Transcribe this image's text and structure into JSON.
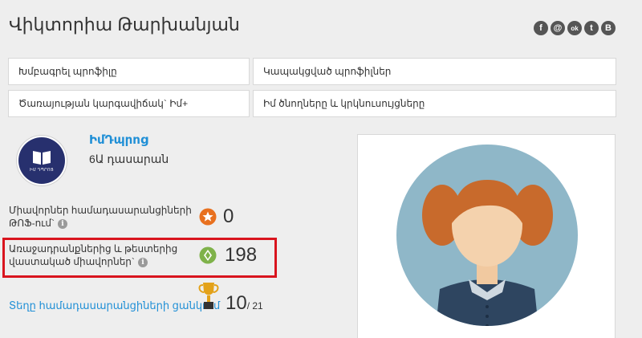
{
  "header": {
    "title": "Վիկտորիա Թարխանյան"
  },
  "socials": [
    {
      "glyph": "f"
    },
    {
      "glyph": "@"
    },
    {
      "glyph": "ok"
    },
    {
      "glyph": "t"
    },
    {
      "glyph": "B"
    }
  ],
  "menu": {
    "edit_profile": "Խմբագրել պրոֆիլը",
    "linked_profiles": "Կապակցված պրոֆիլներ",
    "service_status": "Ծառայության կարգավիճակ` Իմ+",
    "parents_teachers": "Իմ ծնողները և կրկնուսույցները"
  },
  "school": {
    "name": "ԻմԴպրոց",
    "grade": "6Ա դասարան",
    "badge_caption": "ԻՄ ԴՊՐՈՑ"
  },
  "stats": {
    "tof_label_line1": "Միավորներ համադասարանցիների",
    "tof_label_line2": "ԹՈՖ-ում`",
    "tof_value": "0",
    "tests_label_line1": "Առաջադրանքներից և թեստերից",
    "tests_label_line2": "վաստակած միավորներ`",
    "tests_value": "198",
    "info_glyph": "i"
  },
  "ranking": {
    "link_label": "Տեղը համադասարանցիների ցանկում",
    "position": "10",
    "total": "/ 21"
  },
  "colors": {
    "link": "#1f8fd6",
    "highlight": "#d9141e",
    "badge": "#27306e",
    "star_icon": "#e8701e",
    "diamond_icon": "#7fb24a",
    "trophy": "#e3a21a",
    "avatar_bg": "#8fb7c8"
  }
}
